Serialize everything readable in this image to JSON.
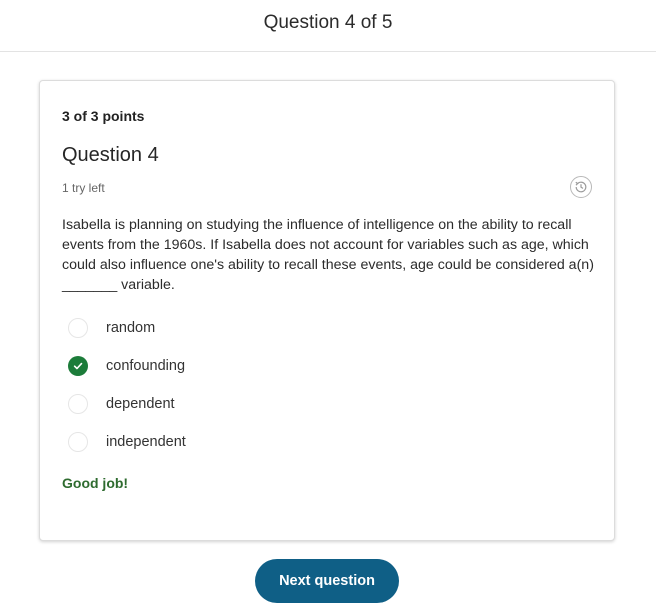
{
  "header": {
    "title": "Question 4 of 5"
  },
  "card": {
    "points": "3 of 3 points",
    "question_title": "Question 4",
    "tries": "1 try left",
    "history_icon": "history-icon",
    "prompt": "Isabella is planning on studying the influence of intelligence on the ability to recall events from the 1960s. If Isabella does not account for variables such as age, which could also influence one's ability to recall these events, age could be considered a(n) _______ variable.",
    "options": [
      {
        "label": "random",
        "selected": false
      },
      {
        "label": "confounding",
        "selected": true
      },
      {
        "label": "dependent",
        "selected": false
      },
      {
        "label": "independent",
        "selected": false
      }
    ],
    "feedback": "Good job!"
  },
  "footer": {
    "next_label": "Next question"
  },
  "colors": {
    "correct": "#1c7c3a",
    "feedback": "#2e6b2f",
    "primary_button": "#0f5f86"
  }
}
